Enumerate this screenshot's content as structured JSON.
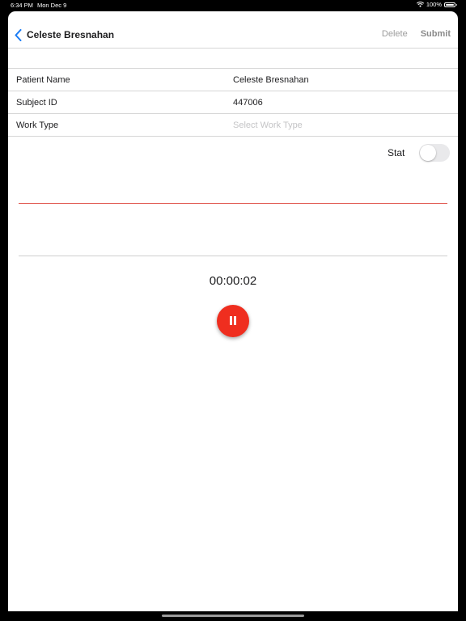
{
  "status_bar": {
    "time": "6:34 PM",
    "date": "Mon Dec 9",
    "battery": "100%"
  },
  "navbar": {
    "title": "Celeste Bresnahan",
    "delete_label": "Delete",
    "submit_label": "Submit"
  },
  "form": {
    "rows": [
      {
        "label": "Patient Name",
        "value": "Celeste Bresnahan"
      },
      {
        "label": "Subject ID",
        "value": "447006"
      },
      {
        "label": "Work Type",
        "placeholder": "Select Work Type"
      }
    ]
  },
  "stat": {
    "label": "Stat",
    "enabled": false
  },
  "recorder": {
    "timer": "00:00:02",
    "state": "recording"
  },
  "colors": {
    "accent": "#1a7cf5",
    "record_button": "#ef2e1f",
    "waveform": "#e0564d"
  }
}
